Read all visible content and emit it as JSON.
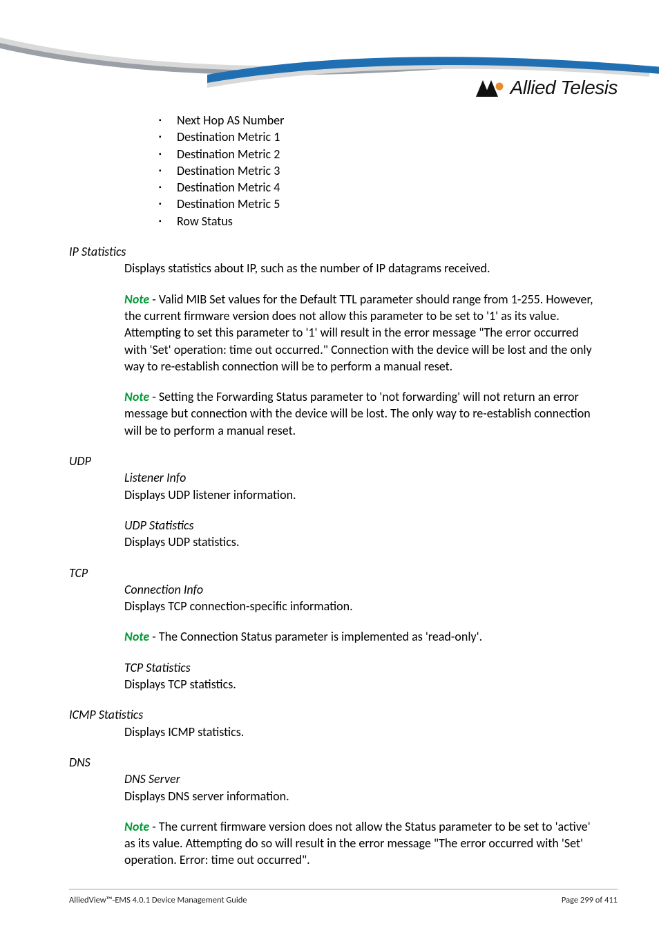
{
  "logo": {
    "brand_text": "Allied Telesis"
  },
  "bullets": [
    "Next Hop AS Number",
    "Destination Metric 1",
    "Destination Metric 2",
    "Destination Metric 3",
    "Destination Metric 4",
    "Destination Metric 5",
    "Row Status"
  ],
  "ip_statistics": {
    "heading": "IP Statistics",
    "desc": "Displays statistics about IP, such as the number of IP datagrams received.",
    "note1_label": "Note",
    "note1_text": " - Valid MIB Set values for the Default TTL parameter should range from 1-255. However, the current firmware version does not allow this parameter to be set to '1' as its value. Attempting to set this parameter to '1' will result in the error message \"The error occurred with 'Set' operation: time out occurred.\" Connection with the device will be lost and the only way to re-establish connection will be to perform a manual reset.",
    "note2_label": "Note",
    "note2_text": " - Setting the Forwarding Status parameter to 'not forwarding' will not return an error message but connection with the device will be lost. The only way to re-establish connection will be to perform a manual reset."
  },
  "udp": {
    "heading": "UDP",
    "listener_head": "Listener Info",
    "listener_desc": "Displays UDP listener information.",
    "stats_head": "UDP Statistics",
    "stats_desc": "Displays UDP statistics."
  },
  "tcp": {
    "heading": "TCP",
    "conn_head": "Connection Info",
    "conn_desc": "Displays TCP connection-specific information.",
    "note_label": "Note",
    "note_text": " - The Connection Status parameter is implemented as 'read-only'.",
    "stats_head": "TCP Statistics",
    "stats_desc": "Displays TCP statistics."
  },
  "icmp": {
    "heading": "ICMP Statistics",
    "desc": "Displays ICMP statistics."
  },
  "dns": {
    "heading": "DNS",
    "server_head": "DNS Server",
    "server_desc": "Displays DNS server information.",
    "note_label": "Note",
    "note_text": " - The current firmware version does not allow the Status parameter to be set to 'active' as its value. Attempting do so will result in the error message \"The error occurred with 'Set' operation. Error: time out occurred\"."
  },
  "footer": {
    "left": "AlliedView™-EMS 4.0.1 Device Management Guide",
    "right": "Page 299 of 411"
  }
}
